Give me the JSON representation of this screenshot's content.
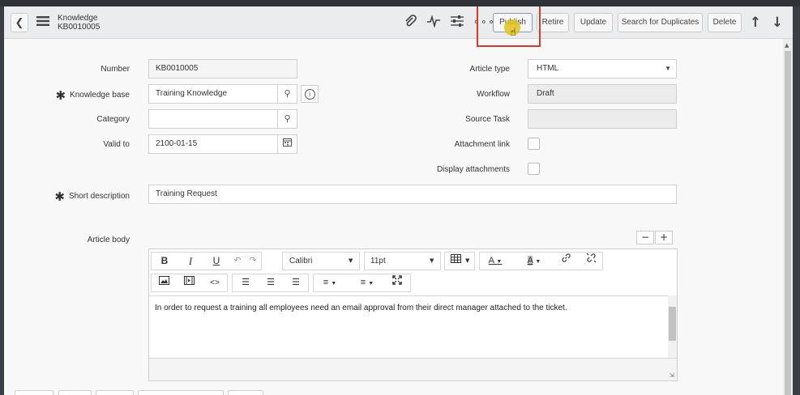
{
  "header": {
    "title": "Knowledge",
    "subtitle": "KB0010005",
    "buttons": [
      "Publish",
      "Retire",
      "Update",
      "Search for Duplicates",
      "Delete"
    ],
    "icons": [
      "back-icon",
      "menu-icon",
      "paperclip-icon",
      "activity-icon",
      "settings-sliders-icon",
      "more-icon",
      "arrow-up-icon",
      "arrow-down-icon"
    ]
  },
  "form": {
    "number_label": "Number",
    "number_value": "KB0010005",
    "kb_label": "Knowledge base",
    "kb_value": "Training Knowledge",
    "category_label": "Category",
    "category_value": "",
    "valid_to_label": "Valid to",
    "valid_to_value": "2100-01-15",
    "short_desc_label": "Short description",
    "short_desc_value": "Training Request",
    "article_type_label": "Article type",
    "article_type_value": "HTML",
    "workflow_label": "Workflow",
    "workflow_value": "Draft",
    "source_task_label": "Source Task",
    "source_task_value": "",
    "attachment_link_label": "Attachment link",
    "display_attachments_label": "Display attachments",
    "article_body_label": "Article body"
  },
  "editor": {
    "font": "Calibri",
    "size": "11pt",
    "body_text": "In order to request a training all employees need an email approval from their direct manager attached to the ticket.",
    "bold": "B",
    "italic": "I",
    "underline": "U",
    "code": "<>",
    "minus": "−",
    "plus": "+"
  },
  "colors": {
    "highlight": "#d63a2a",
    "cursor_marker": "#e4c21a"
  }
}
